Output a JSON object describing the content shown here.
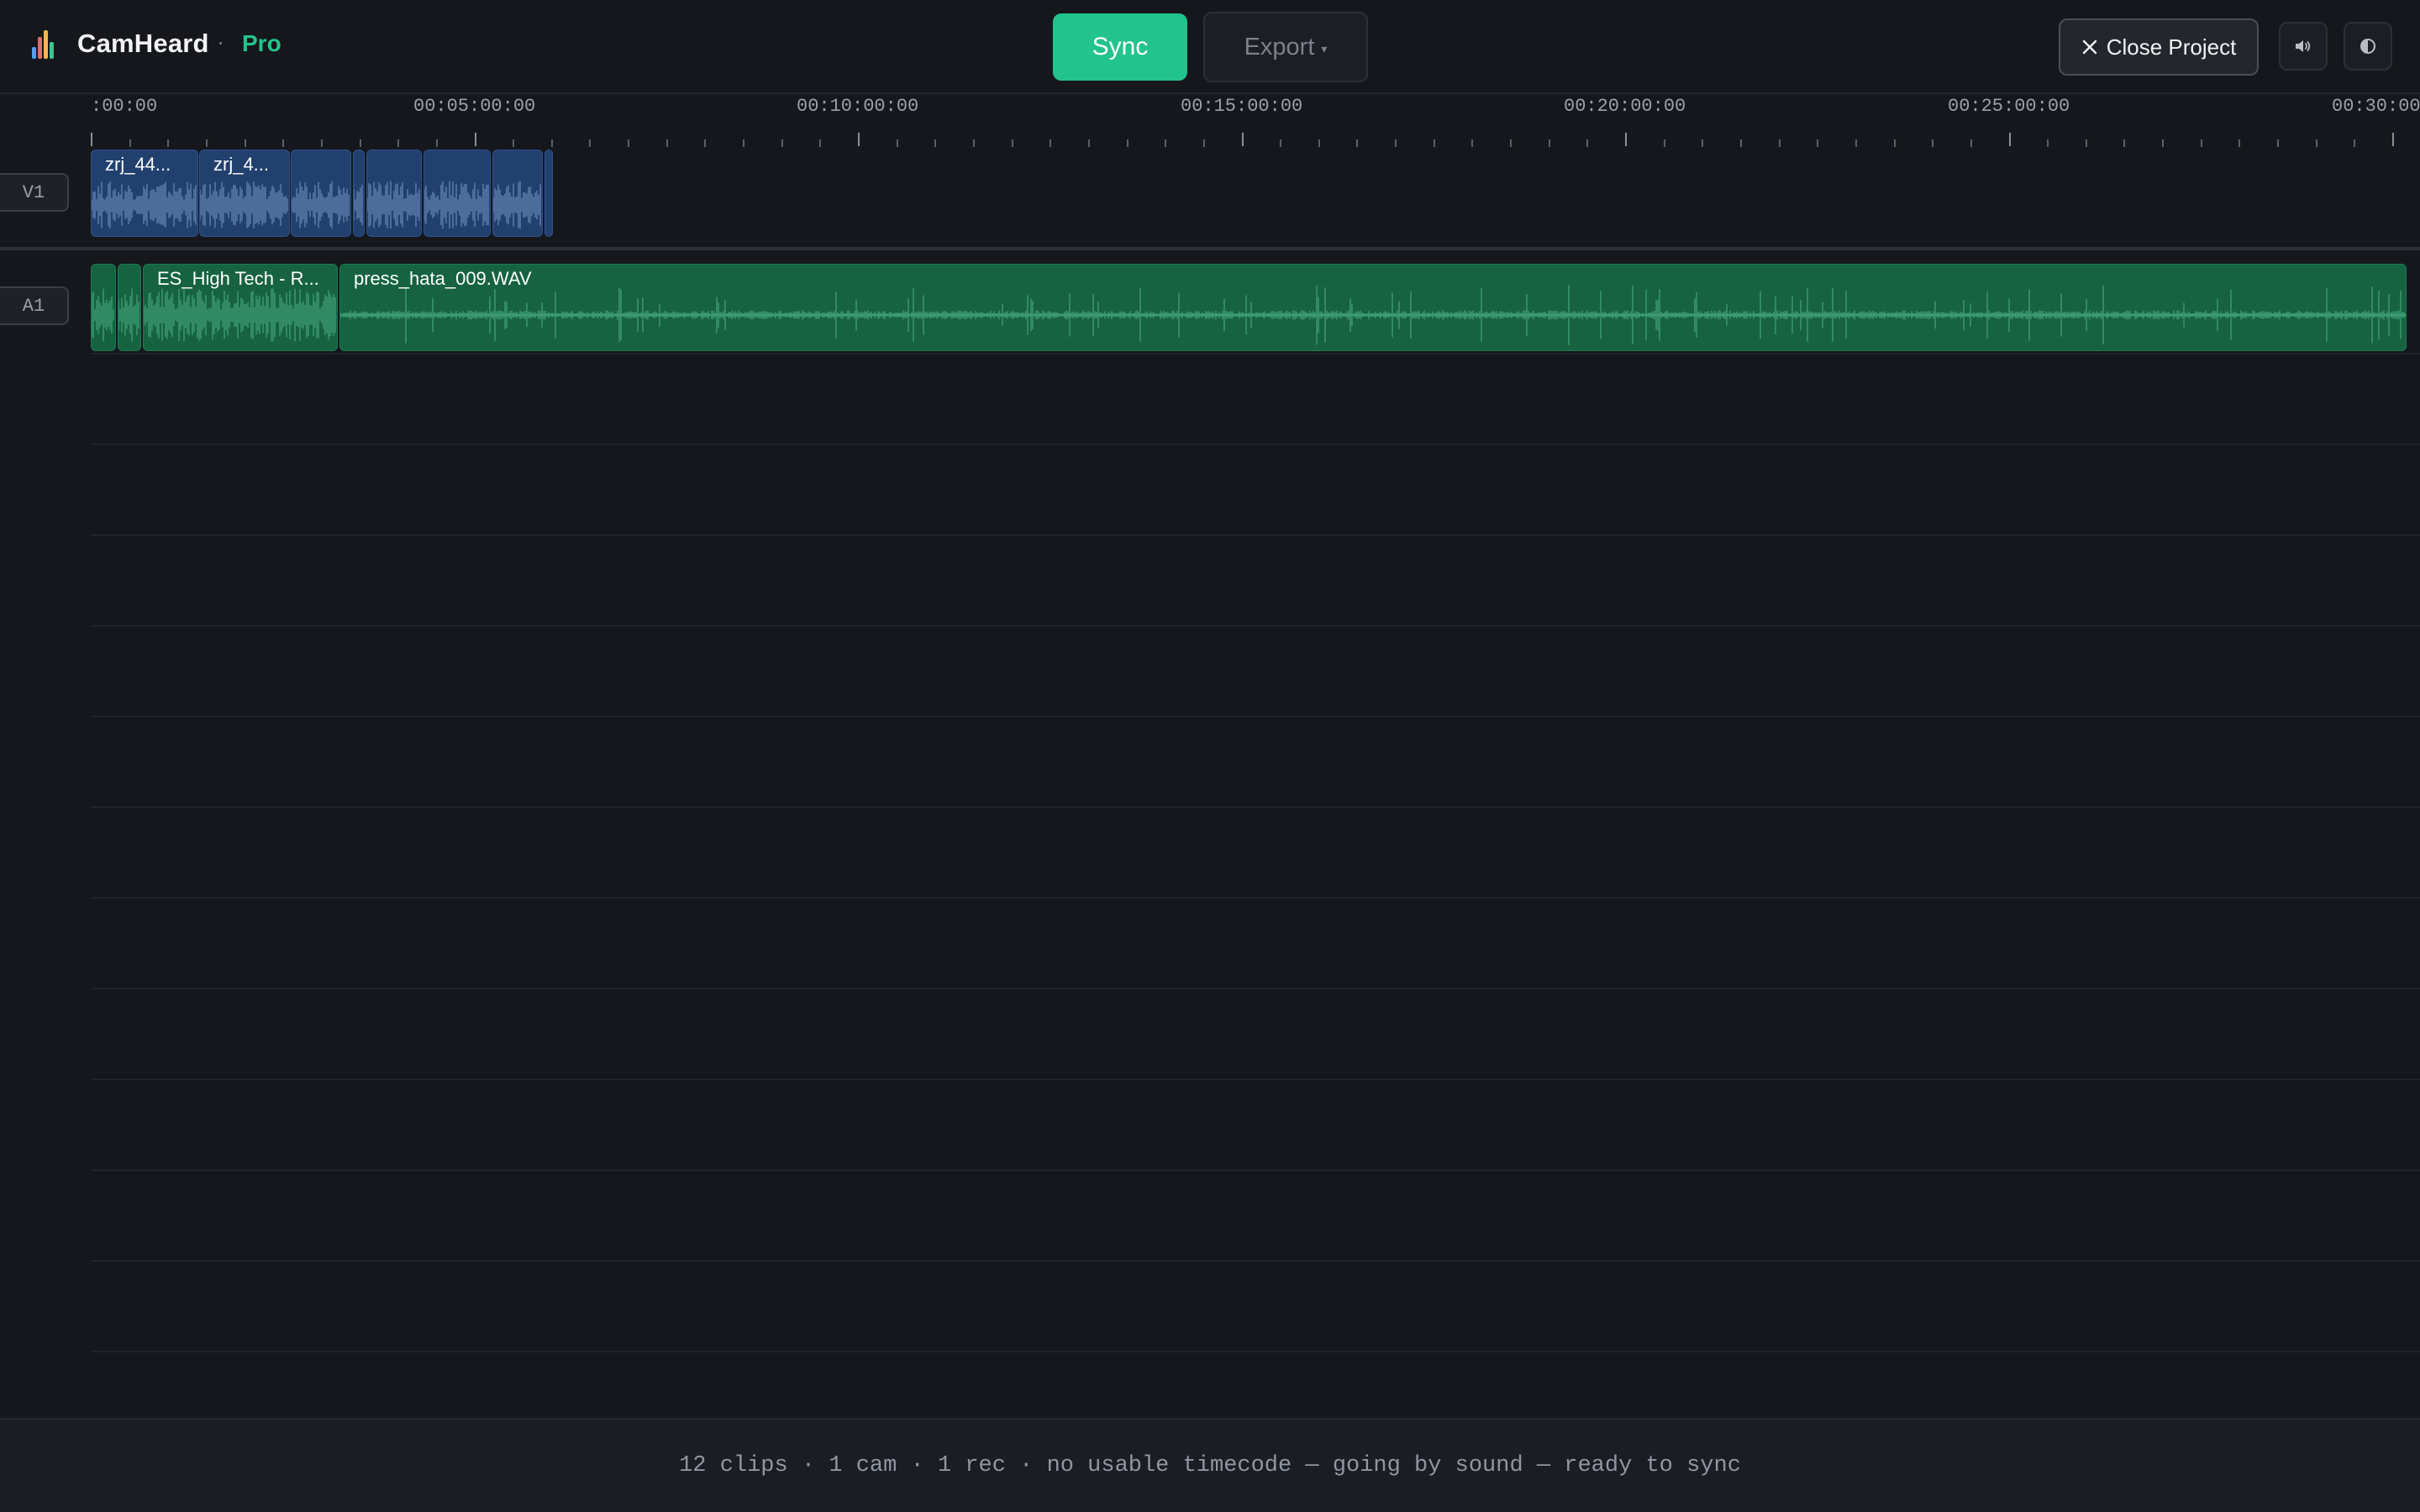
{
  "app": {
    "name": "CamHeard",
    "separator": "·",
    "tier": "Pro",
    "accent_color": "#23c48a",
    "logo_icon": "waveform-logo-icon"
  },
  "toolbar": {
    "sync_label": "Sync",
    "sync_color": "#22c38c",
    "export_label": "Export",
    "export_caret": "▾",
    "close_label": "Close Project",
    "volume_icon": "speaker-icon",
    "theme_icon": "contrast-icon"
  },
  "ruler": {
    "labels": [
      ":00:00",
      "00:05:00:00",
      "00:10:00:00",
      "00:15:00:00",
      "00:20:00:00",
      "00:25:00:00",
      "00:30:00"
    ]
  },
  "tracks": [
    {
      "id": "V1",
      "type": "video",
      "clips": [
        {
          "name": "zrj_44..."
        },
        {
          "name": "zrj_4..."
        },
        {
          "name": ""
        },
        {
          "name": ""
        },
        {
          "name": ""
        },
        {
          "name": ""
        },
        {
          "name": ""
        },
        {
          "name": ""
        }
      ]
    },
    {
      "id": "A1",
      "type": "audio",
      "clips": [
        {
          "name": ""
        },
        {
          "name": ""
        },
        {
          "name": "ES_High Tech - R..."
        },
        {
          "name": "press_hata_009.WAV"
        }
      ]
    }
  ],
  "status": {
    "text": "12 clips · 1 cam · 1 rec · no usable timecode — going by sound — ready to sync"
  }
}
